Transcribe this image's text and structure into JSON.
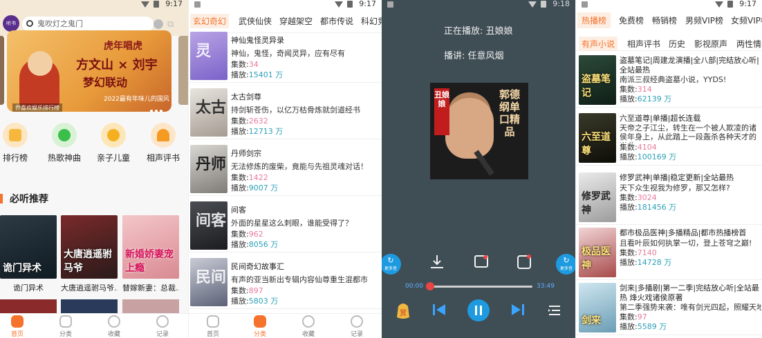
{
  "status": {
    "time_a": "9:17",
    "time_b": "9:17",
    "time_c": "9:18",
    "time_d": "9:17"
  },
  "home": {
    "logo": "听书",
    "search_placeholder": "鬼吹灯之鬼门",
    "banner": {
      "tag": "虎年唱虎",
      "title": "方文山 × 刘宇",
      "subtitle": "梦幻联动",
      "year_line": "2022最有年味儿的国风",
      "rank_tag": "乔喜欢娱乐排行榜"
    },
    "categories": [
      {
        "label": "排行榜",
        "icon": "ranking-icon"
      },
      {
        "label": "热歌神曲",
        "icon": "mic-icon"
      },
      {
        "label": "亲子儿童",
        "icon": "bear-icon"
      },
      {
        "label": "相声评书",
        "icon": "fan-icon"
      }
    ],
    "section_title": "必听推荐",
    "books": [
      {
        "title": "诡门异术",
        "cover_text": "诡门异术"
      },
      {
        "title": "大唐逍遥驸马爷...",
        "cover_text": "大唐逍遥驸马爷"
      },
      {
        "title": "替嫁新妻：总裁...",
        "cover_text": "新婚娇妻宠上瘾"
      }
    ]
  },
  "nav_home": [
    "首页",
    "分类",
    "收藏",
    "记录"
  ],
  "nav_class": [
    "首页",
    "分类",
    "收藏",
    "记录"
  ],
  "classify": {
    "tabs": [
      "玄幻奇幻",
      "武侠仙侠",
      "穿越架空",
      "都市传说",
      "科幻竞"
    ],
    "items": [
      {
        "title": "神仙鬼怪灵异录",
        "desc": "神仙，鬼怪，奇闻灵异，应有尽有",
        "episodes_label": "集数:",
        "episodes": "34",
        "plays_label": "播放:",
        "plays": "15401 万",
        "cover": "灵"
      },
      {
        "title": "太古剑尊",
        "desc": "持剑斩苍伤，以亿万枯骨炼就剑道经书",
        "episodes_label": "集数:",
        "episodes": "2632",
        "plays_label": "播放:",
        "plays": "12713 万",
        "cover": "太古"
      },
      {
        "title": "丹师剑宗",
        "desc": "无法修炼的废柴，竟能与先祖灵魂对话！",
        "episodes_label": "集数:",
        "episodes": "1422",
        "plays_label": "播放:",
        "plays": "9007 万",
        "cover": "丹师"
      },
      {
        "title": "间客",
        "desc": "外面的星星这么刺眼，谁能受得了？",
        "episodes_label": "集数:",
        "episodes": "962",
        "plays_label": "播放:",
        "plays": "8056 万",
        "cover": "间客"
      },
      {
        "title": "民间奇幻故事汇",
        "desc": "有声的亚当新出专辑内容仙尊重生混都市",
        "episodes_label": "集数:",
        "episodes": "897",
        "plays_label": "播放:",
        "plays": "5803 万",
        "cover": "民间"
      }
    ]
  },
  "player": {
    "now_playing": "正在播放: 丑娘娘",
    "host": "播讲: 任意风烟",
    "cover_tag": "丑娘娘",
    "cover_title": "郭德纲单口精品",
    "side_left": "更多音",
    "side_right": "更多音",
    "time_start": "00:00",
    "time_end": "33:49",
    "progress": 0.0
  },
  "ranking": {
    "tabs": [
      "热播榜",
      "免费榜",
      "畅销榜",
      "男频VIP榜",
      "女频VIP榜"
    ],
    "subtabs": [
      "有声小说",
      "相声评书",
      "历史",
      "影视原声",
      "两性情感"
    ],
    "items": [
      {
        "title": "盗墓笔记|周建龙演播|全八部|完结放心听|全站最热",
        "desc": "南派三叔经典盗墓小说，YYDS!",
        "episodes_label": "集数:",
        "episodes": "314",
        "plays_label": "播放:",
        "plays": "62139 万",
        "cover": "盗墓笔记"
      },
      {
        "title": "六至道尊|单播|超长连载",
        "desc": "天帝之子江尘，转生在一个被人欺凌的诸侯年身上，从此踏上一段轰杀各种天才的逆袭",
        "episodes_label": "集数:",
        "episodes": "4104",
        "plays_label": "播放:",
        "plays": "100169 万",
        "cover": "六至道尊"
      },
      {
        "title": "修罗武神|单播|稳定更新|全站最热",
        "desc": "天下众生视我为修罗，那又怎样?",
        "episodes_label": "集数:",
        "episodes": "3024",
        "plays_label": "播放:",
        "plays": "181456 万",
        "cover": "修罗武神"
      },
      {
        "title": "都市极品医神|多播精品|都市热播榜首",
        "desc": "且看叶辰如何执掌一切，登上苍穹之巅!",
        "episodes_label": "集数:",
        "episodes": "7140",
        "plays_label": "播放:",
        "plays": "14728 万",
        "cover": "极品医神"
      },
      {
        "title": "剑来|多播剧|第一二季|完结放心听|全站最热 烽火戏诸侯原著",
        "desc": "第二季强势来袭：唯有剑光四起，照耀天地",
        "episodes_label": "集数:",
        "episodes": "97",
        "plays_label": "播放:",
        "plays": "5589 万",
        "cover": "剑来"
      }
    ]
  },
  "colors": {
    "accent": "#f5732c",
    "episodes": "#e87a9b",
    "plays": "#2a9fb8",
    "player_bg": "#3f4d55",
    "player_btn": "#1e9be0"
  }
}
